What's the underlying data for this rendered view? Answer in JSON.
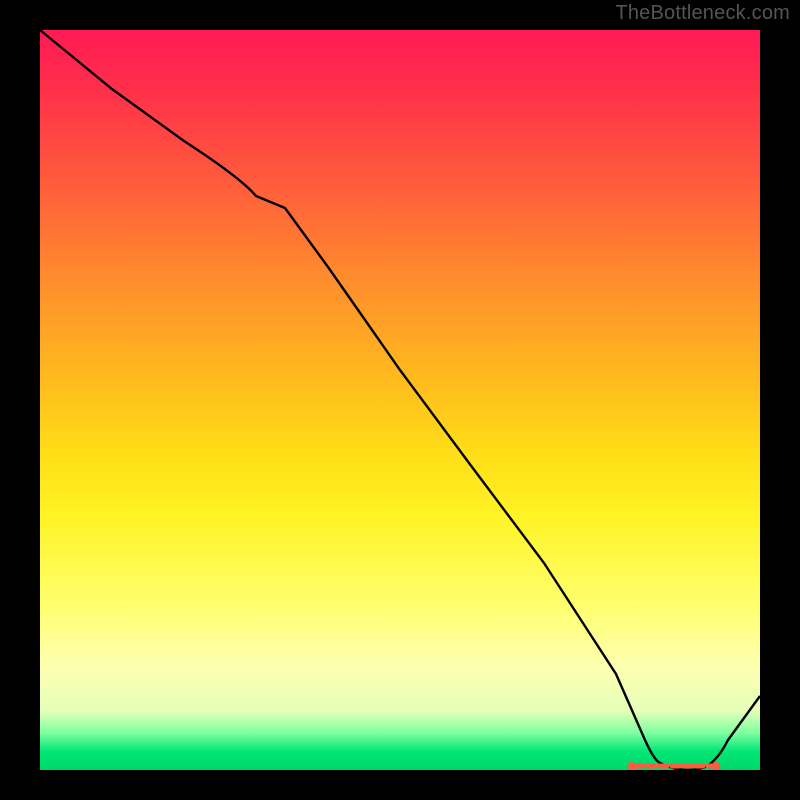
{
  "watermark": "TheBottleneck.com",
  "chart_data": {
    "type": "line",
    "title": "",
    "xlabel": "",
    "ylabel": "",
    "xlim": [
      0,
      100
    ],
    "ylim_bottleneck_pct": [
      0,
      100
    ],
    "note": "y read as distance from bottom green baseline (0 = green/no bottleneck, 100 = top/red)",
    "series": [
      {
        "name": "bottleneck-curve",
        "x": [
          0,
          10,
          20,
          28,
          34,
          40,
          50,
          60,
          70,
          80,
          84,
          86,
          88,
          90,
          92,
          94,
          100
        ],
        "y": [
          100,
          92,
          85,
          80,
          76,
          68,
          54,
          41,
          28,
          13,
          4,
          1,
          0,
          0,
          0,
          1,
          10
        ]
      }
    ],
    "optimal_range_marker": {
      "name": "optimal-span",
      "x_start": 82,
      "x_end": 94,
      "color": "#ff5a3c"
    },
    "gradient_stops": [
      {
        "pos": 0,
        "color": "#ff1a56"
      },
      {
        "pos": 0.5,
        "color": "#ffe017"
      },
      {
        "pos": 0.86,
        "color": "#fdffb0"
      },
      {
        "pos": 1.0,
        "color": "#00d66a"
      }
    ]
  }
}
